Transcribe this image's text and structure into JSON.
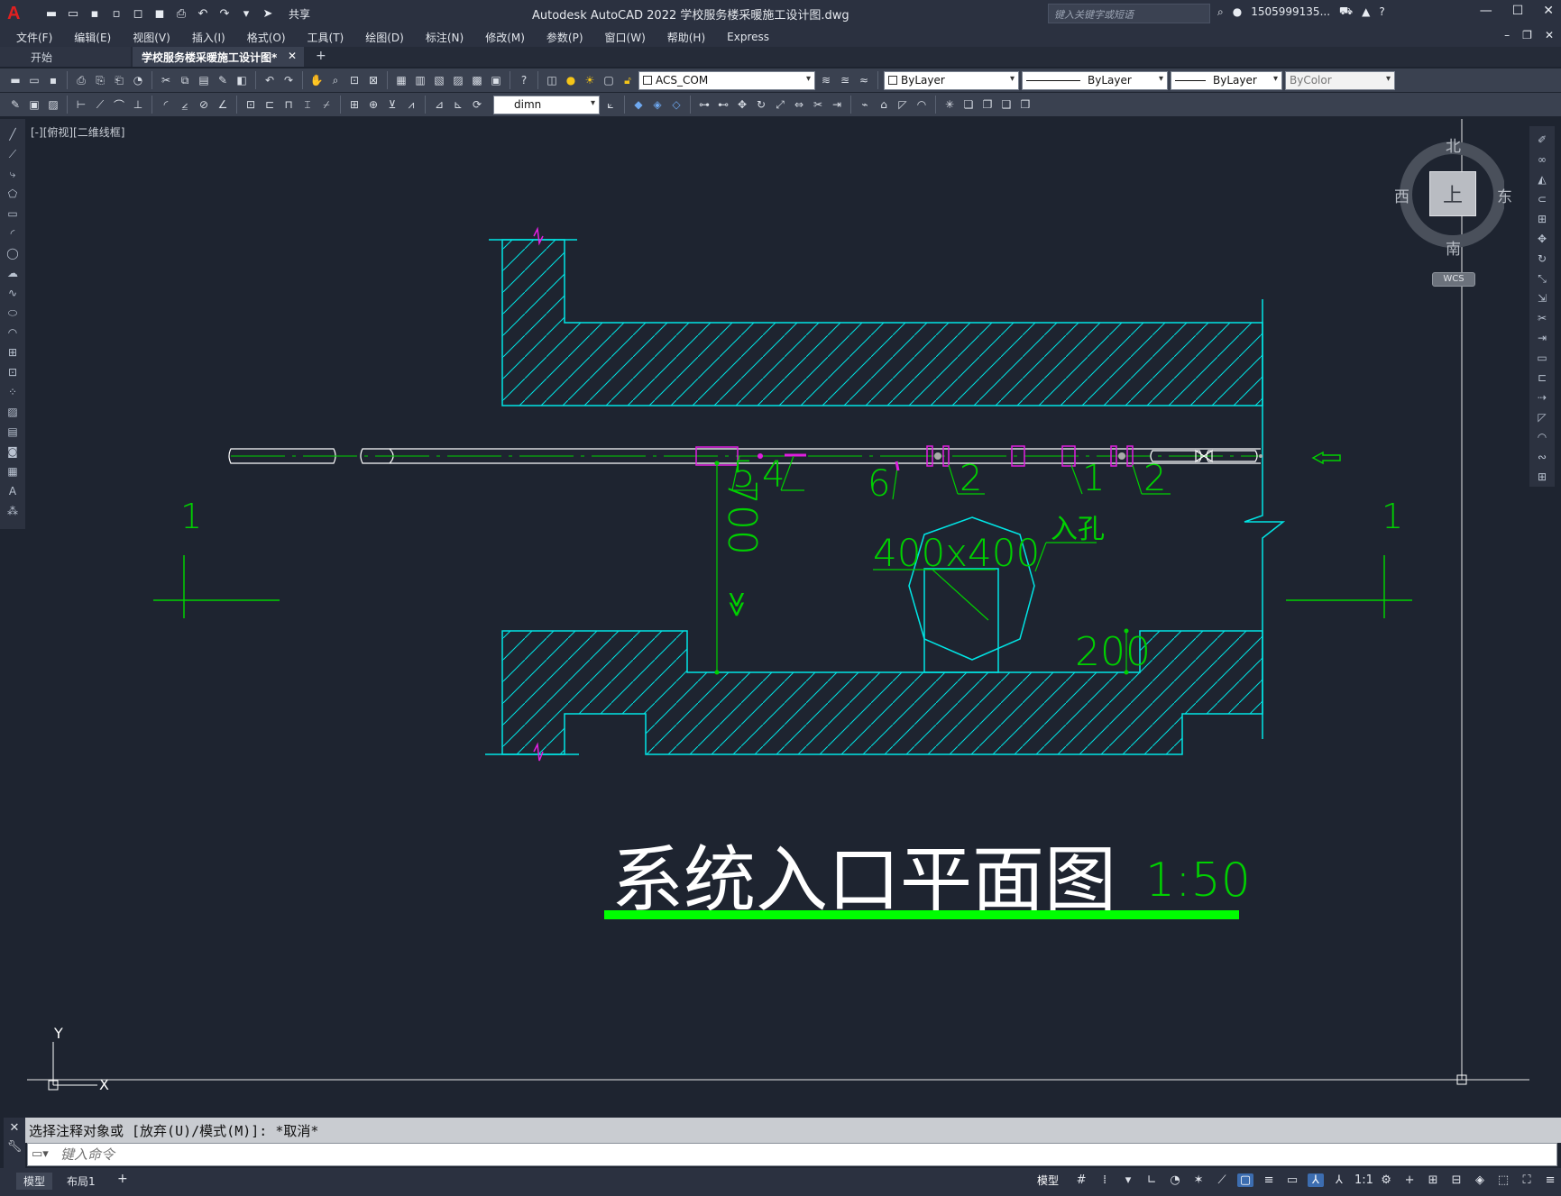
{
  "titlebar": {
    "share_label": "共享",
    "app_title": "Autodesk AutoCAD 2022    学校服务楼采暖施工设计图.dwg",
    "search_placeholder": "键入关键字或短语",
    "user": "1505999135...",
    "help": "?"
  },
  "menu": {
    "items": [
      "文件(F)",
      "编辑(E)",
      "视图(V)",
      "插入(I)",
      "格式(O)",
      "工具(T)",
      "绘图(D)",
      "标注(N)",
      "修改(M)",
      "参数(P)",
      "窗口(W)",
      "帮助(H)",
      "Express"
    ]
  },
  "tabs": {
    "start": "开始",
    "active": "学校服务楼采暖施工设计图*"
  },
  "toolbar": {
    "layer": "ACS_COM",
    "color": "ByLayer",
    "linetype": "ByLayer",
    "lineweight": "ByLayer",
    "plotstyle": "ByColor",
    "dimstyle": "dimn"
  },
  "viewport": {
    "label": "[-][俯视][二维线框]"
  },
  "viewcube": {
    "north": "北",
    "south": "南",
    "east": "东",
    "west": "西",
    "top": "上",
    "wcs": "WCS"
  },
  "drawing": {
    "section_left": "1",
    "section_right": "1",
    "labels": [
      "5",
      "4",
      "6",
      "2",
      "1",
      "2"
    ],
    "dim_700": "700",
    "dim_400": "400x400",
    "manhole": "入孔",
    "dim_200": "200",
    "title": "系统入口平面图",
    "scale": "1:50",
    "ucs_x": "X",
    "ucs_y": "Y"
  },
  "command": {
    "history": "选择注释对象或 [放弃(U)/模式(M)]: *取消*",
    "input_placeholder": "键入命令"
  },
  "status": {
    "model_tab": "模型",
    "layout_tab": "布局1",
    "add_tab": "+",
    "model_label": "模型",
    "scale": "1:1"
  },
  "colors": {
    "background": "#1e2430",
    "cyan": "#00e5e5",
    "green": "#00d000",
    "magenta": "#e020e0",
    "white": "#ffffff",
    "title_bar_green": "#00ff00"
  }
}
